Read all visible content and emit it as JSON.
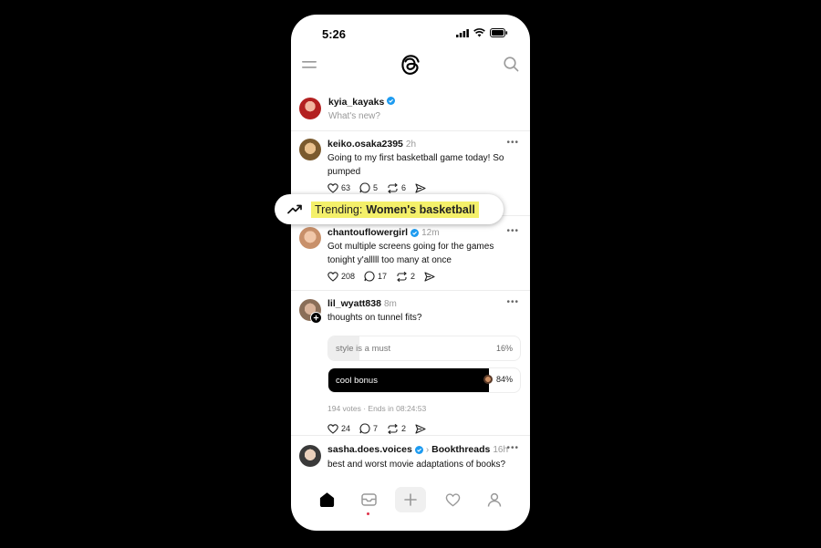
{
  "status": {
    "time": "5:26"
  },
  "composer": {
    "username": "kyia_kayaks",
    "placeholder": "What's new?"
  },
  "posts": [
    {
      "username": "keiko.osaka2395",
      "time": "2h",
      "text": "Going to my first basketball game today! So pumped",
      "likes": "63",
      "replies": "5",
      "reposts": "6"
    },
    {
      "username": "chantouflowergirl",
      "time": "12m",
      "text": "Got multiple screens going for the games tonight y'alllll too many at once",
      "likes": "208",
      "replies": "17",
      "reposts": "2"
    },
    {
      "username": "lil_wyatt838",
      "time": "8m",
      "text": "thoughts on tunnel fits?",
      "likes": "24",
      "replies": "7",
      "reposts": "2",
      "poll": {
        "options": [
          {
            "label": "style is a must",
            "percent": "16%",
            "fraction": 0.16
          },
          {
            "label": "cool bonus",
            "percent": "84%",
            "fraction": 0.84
          }
        ],
        "meta": "194 votes · Ends in 08:24:53"
      }
    },
    {
      "username": "sasha.does.voices",
      "community": "Bookthreads",
      "time": "16h",
      "text": "best and worst movie adaptations of books?"
    }
  ],
  "trending": {
    "prefix": "Trending:",
    "topic": "Women's basketball"
  },
  "colors": {
    "verified": "#1d9bf0",
    "highlight": "#f4f06a",
    "notification_dot": "#e0334a"
  },
  "icons": {
    "menu": "menu-icon",
    "logo": "threads-logo-icon",
    "search": "search-icon",
    "like": "heart-icon",
    "reply": "comment-icon",
    "repost": "repost-icon",
    "share": "send-icon",
    "nav": [
      "home-icon",
      "inbox-icon",
      "plus-icon",
      "heart-icon",
      "profile-icon"
    ]
  }
}
